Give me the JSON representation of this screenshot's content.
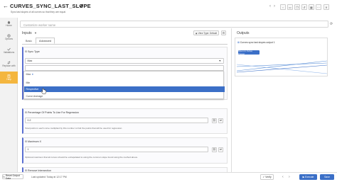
{
  "header": {
    "title": "CURVES_SYNC_LAST_SLOPE",
    "subtitle": "Sync last slopes of all curves so that they are equal"
  },
  "sidebar": {
    "items": [
      {
        "label": "Home",
        "icon": "home-icon"
      },
      {
        "label": "Options",
        "icon": "options-icon"
      },
      {
        "label": "Validations",
        "icon": "validations-icon"
      },
      {
        "label": "Replace with",
        "icon": "replace-icon"
      },
      {
        "label": "Help",
        "icon": "help-icon"
      }
    ]
  },
  "search": {
    "placeholder": "Customize worker name"
  },
  "inputs": {
    "label": "Inputs",
    "view_type_default": "View Type: Default",
    "tabs": [
      {
        "label": "Basic"
      },
      {
        "label": "Advanced"
      }
    ],
    "sync_type": {
      "label": "Sync Type",
      "value": "Max",
      "search_value": "",
      "options": [
        {
          "label": "Max"
        },
        {
          "label": "Min"
        },
        {
          "label": "Respective"
        },
        {
          "label": "Curve Average"
        }
      ],
      "selected_index": 2
    },
    "percentage": {
      "label": "Percentage Of Points To Use For Regression",
      "value": "0.2",
      "help": "Total points in each curve multiplied by this number to find the points that will be used for regression"
    },
    "maximum_x": {
      "label": "Maximum X",
      "value": "1",
      "help": "Optional maximum that all curves should be extrapolated to using the common slope found using the method above."
    },
    "remove_intersection": {
      "label": "Remove Intersection"
    }
  },
  "outputs": {
    "label": "Outputs",
    "item_label": "Curves sync last slopes output 1",
    "open_button": "Open in Curve Viewer"
  },
  "footer": {
    "reset_label": "Reset Output Data",
    "last_updated": "Last updated: Today at 12:17 PM",
    "verify_label": "Verify",
    "execute_label": "Execute",
    "save_label": "Save"
  },
  "colors": {
    "accent": "#3b6fc7",
    "sidebar_active": "#f4b63f",
    "section_border": "#5a6fd1"
  }
}
